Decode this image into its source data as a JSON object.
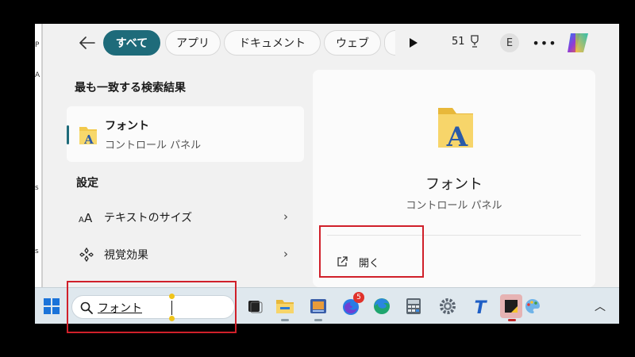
{
  "background": {
    "marks": [
      "P",
      "A",
      "s",
      "s"
    ]
  },
  "header": {
    "filters": [
      {
        "label": "すべて",
        "active": true
      },
      {
        "label": "アプリ",
        "active": false
      },
      {
        "label": "ドキュメント",
        "active": false
      },
      {
        "label": "ウェブ",
        "active": false
      }
    ],
    "points": "51",
    "avatar_initial": "E"
  },
  "results": {
    "best_match_heading": "最も一致する検索結果",
    "best_match": {
      "title": "フォント",
      "subtitle": "コントロール パネル"
    },
    "settings_heading": "設定",
    "settings": [
      {
        "label": "テキストのサイズ",
        "icon": "text-size-icon"
      },
      {
        "label": "視覚効果",
        "icon": "visual-effects-icon"
      }
    ]
  },
  "detail": {
    "title": "フォント",
    "subtitle": "コントロール パネル",
    "open_label": "開く"
  },
  "taskbar": {
    "search_value": "フォント",
    "edge_badge": "5",
    "apps": [
      "task-view",
      "file-explorer",
      "media-player",
      "firefox",
      "edge",
      "calculator",
      "settings",
      "typora",
      "sticky-notes",
      "paint"
    ]
  },
  "colors": {
    "accent": "#1e6b7a",
    "annotation": "#d0202a",
    "taskbar": "#dfe8ee",
    "badge": "#e0322b"
  }
}
